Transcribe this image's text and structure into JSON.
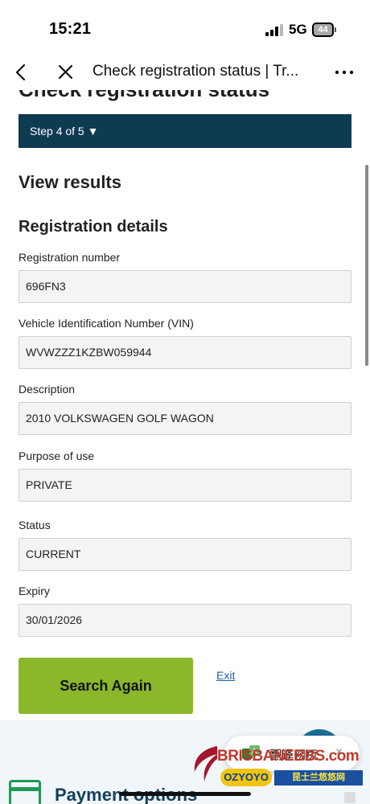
{
  "status_bar": {
    "time": "15:21",
    "network": "5G",
    "battery": "44"
  },
  "browser": {
    "title": "Check registration status | Tr...",
    "icons": {
      "back": "chevron-left-icon",
      "close": "close-icon",
      "more": "more-horizontal-icon"
    }
  },
  "page": {
    "heading": "Check registration status",
    "step": "Step 4 of 5 ▼",
    "results_heading": "View results",
    "details_heading": "Registration details"
  },
  "fields": [
    {
      "label": "Registration number",
      "value": "696FN3"
    },
    {
      "label": "Vehicle Identification Number (VIN)",
      "value": "WVWZZZ1KZBW059944"
    },
    {
      "label": "Description",
      "value": "2010 VOLKSWAGEN GOLF WAGON"
    },
    {
      "label": "Purpose of use",
      "value": "PRIVATE"
    },
    {
      "label": "Status",
      "value": "CURRENT"
    },
    {
      "label": "Expiry",
      "value": "30/01/2026"
    }
  ],
  "actions": {
    "search_again": "Search Again",
    "exit": "Exit"
  },
  "footer": {
    "payment_options": "Payment options"
  },
  "overlay": {
    "translate_label": "翻译网页",
    "translate_close": "×",
    "watermark_main": "BRISBANEBBS.com",
    "watermark_oz": "OZYOYO",
    "watermark_sub": "昆士兰悠悠网"
  },
  "colors": {
    "step_bar": "#0e3a52",
    "primary_button": "#8ab82a",
    "link": "#1d5fa0",
    "footer_bg": "#f1f6fa",
    "payment_icon": "#1f9a55"
  }
}
